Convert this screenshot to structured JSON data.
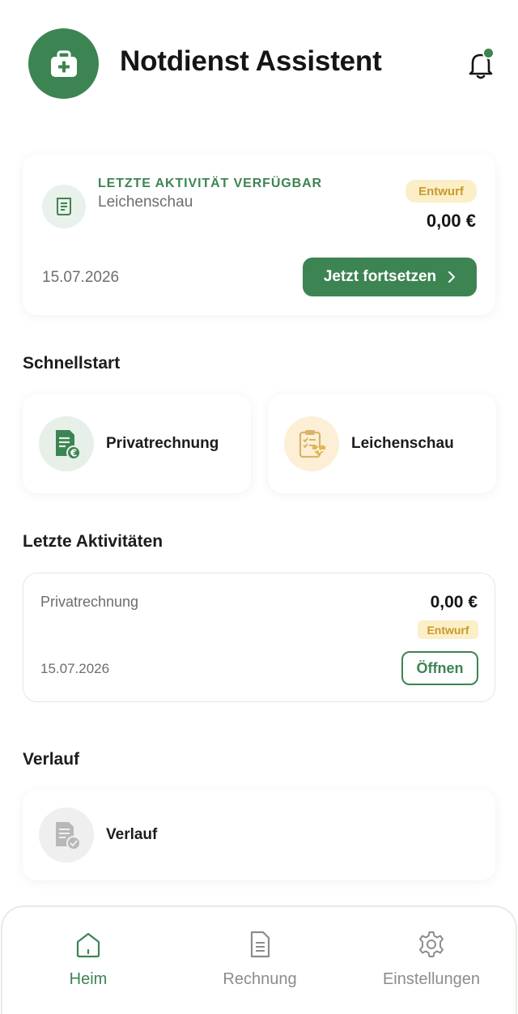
{
  "header": {
    "title": "Notdienst Assistent",
    "logo_icon": "medical-kit-icon",
    "notification_icon": "bell-icon",
    "has_notification": true
  },
  "last_activity": {
    "kicker": "LETZTE AKTIVITÄT VERFÜGBAR",
    "type": "Leichenschau",
    "status": "Entwurf",
    "amount": "0,00 €",
    "date": "15.07.2026",
    "continue_label": "Jetzt fortsetzen",
    "icon": "receipt-icon"
  },
  "quickstart": {
    "title": "Schnellstart",
    "items": [
      {
        "label": "Privatrechnung",
        "icon": "invoice-euro-icon"
      },
      {
        "label": "Leichenschau",
        "icon": "clipboard-heart-icon"
      }
    ]
  },
  "recent": {
    "title": "Letzte Aktivitäten",
    "items": [
      {
        "type": "Privatrechnung",
        "amount": "0,00 €",
        "status": "Entwurf",
        "date": "15.07.2026",
        "open_label": "Öffnen"
      }
    ]
  },
  "history": {
    "title": "Verlauf",
    "label": "Verlauf",
    "icon": "history-document-icon"
  },
  "nav": {
    "items": [
      {
        "label": "Heim",
        "icon": "home-icon",
        "active": true
      },
      {
        "label": "Rechnung",
        "icon": "document-icon",
        "active": false
      },
      {
        "label": "Einstellungen",
        "icon": "gear-icon",
        "active": false
      }
    ]
  },
  "colors": {
    "primary": "#3d8453",
    "badge_bg": "#fbefc8",
    "badge_text": "#c99a2a"
  }
}
